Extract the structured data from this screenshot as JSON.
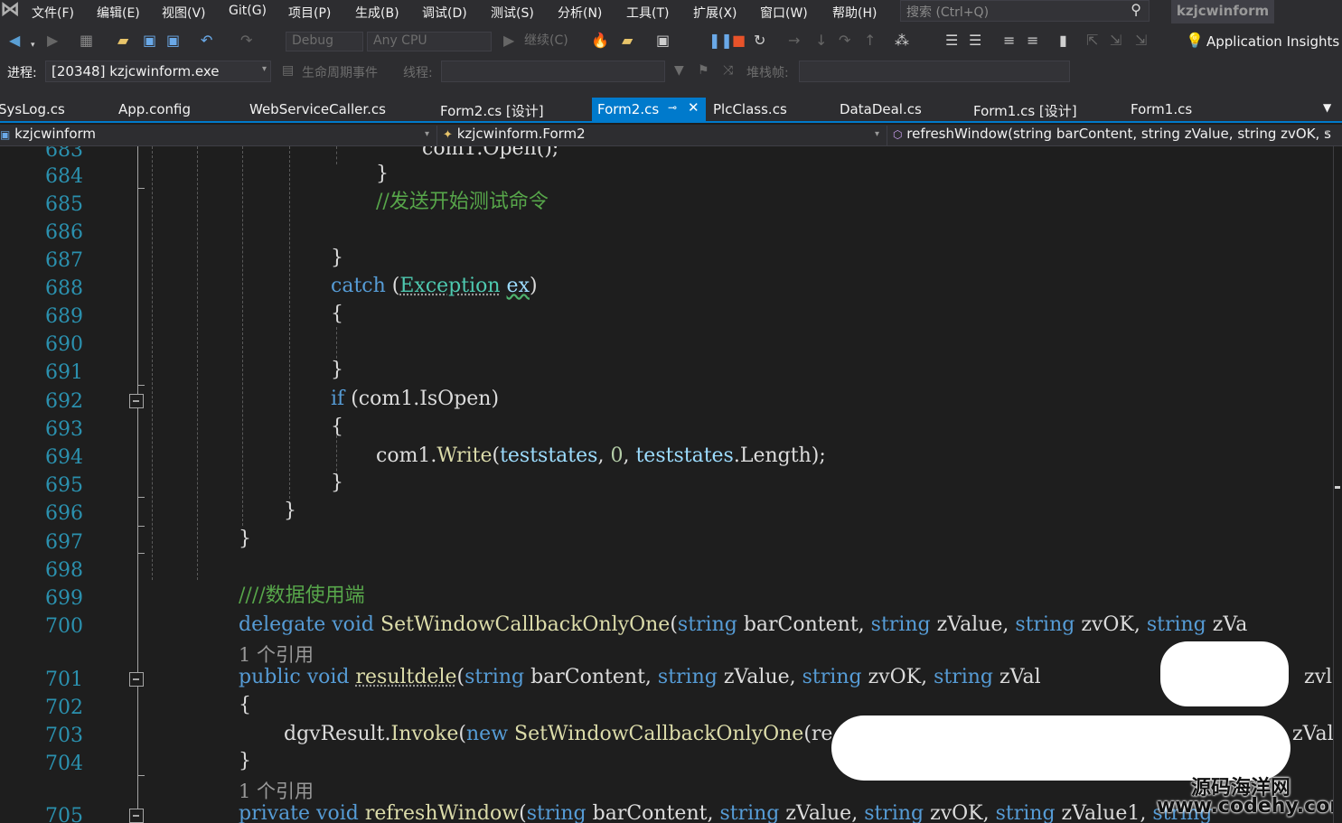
{
  "menubar": {
    "items": [
      "文件(F)",
      "编辑(E)",
      "视图(V)",
      "Git(G)",
      "项目(P)",
      "生成(B)",
      "调试(D)",
      "测试(S)",
      "分析(N)",
      "工具(T)",
      "扩展(X)",
      "窗口(W)",
      "帮助(H)"
    ],
    "search_placeholder": "搜索 (Ctrl+Q)",
    "app_title": "kzjcwinform"
  },
  "toolbar": {
    "config": "Debug",
    "platform": "Any CPU",
    "continue_label": "继续(C)",
    "app_insights": "Application Insights"
  },
  "process_bar": {
    "process_label": "进程:",
    "process_value": "[20348] kzjcwinform.exe",
    "lifecycle_label": "生命周期事件",
    "thread_label": "线程:",
    "stack_label": "堆栈帧:"
  },
  "tabs": [
    "SysLog.cs",
    "App.config",
    "WebServiceCaller.cs",
    "Form2.cs [设计]",
    "Form2.cs",
    "PlcClass.cs",
    "DataDeal.cs",
    "Form1.cs [设计]",
    "Form1.cs"
  ],
  "active_tab": "Form2.cs",
  "navbar": {
    "project": "kzjcwinform",
    "class": "kzjcwinform.Form2",
    "member": "refreshWindow(string barContent, string zValue, string zvOK, s"
  },
  "editor": {
    "line_numbers": [
      "683",
      "684",
      "685",
      "686",
      "687",
      "688",
      "689",
      "690",
      "691",
      "692",
      "693",
      "694",
      "695",
      "696",
      "697",
      "698",
      "699",
      "700",
      "701",
      "702",
      "703",
      "704",
      "705"
    ],
    "code": {
      "l683": "com1.Open();",
      "l684": "}",
      "l685": "//发送开始测试命令",
      "l687": "}",
      "l688_kw": "catch",
      "l688_type": "Exception",
      "l688_var": "ex",
      "l689": "{",
      "l691": "}",
      "l692_kw": "if",
      "l692_rest": "(com1.IsOpen)",
      "l693": "{",
      "l694_obj": "com1.",
      "l694_fn": "Write",
      "l694_arg1": "teststates",
      "l694_num": "0",
      "l694_arg3": "teststates",
      "l694_prop": "Length",
      "l695": "}",
      "l696": "}",
      "l697": "}",
      "l699": "////数据使用端",
      "l700_kw": "delegate void",
      "l700_fn": "SetWindowCallbackOnlyOne",
      "l700_params": "barContent,",
      "l700_p2": "zValue,",
      "l700_p3": "zvOK,",
      "l700_p4": "zVa",
      "ref_count": "1 个引用",
      "l701_kw": "public void",
      "l701_fn": "resultdele",
      "l701_p4": "zVal",
      "l701_tail": "zvl",
      "l702": "{",
      "l703_obj": "dgvResult.",
      "l703_fn": "Invoke",
      "l703_new": "new",
      "l703_type": "SetWindowCallbackOnlyOne",
      "l703_rest": "(re",
      "l703_tail": "zVal",
      "l704": "}",
      "ref_count2": "1 个引用",
      "l705_kw": "private void",
      "l705_fn": "refreshWindow",
      "l705_p4": "zValue1,",
      "string_kw": "string"
    }
  },
  "watermark": {
    "line1": "源码海洋网",
    "line2": "www.codehy.com"
  }
}
